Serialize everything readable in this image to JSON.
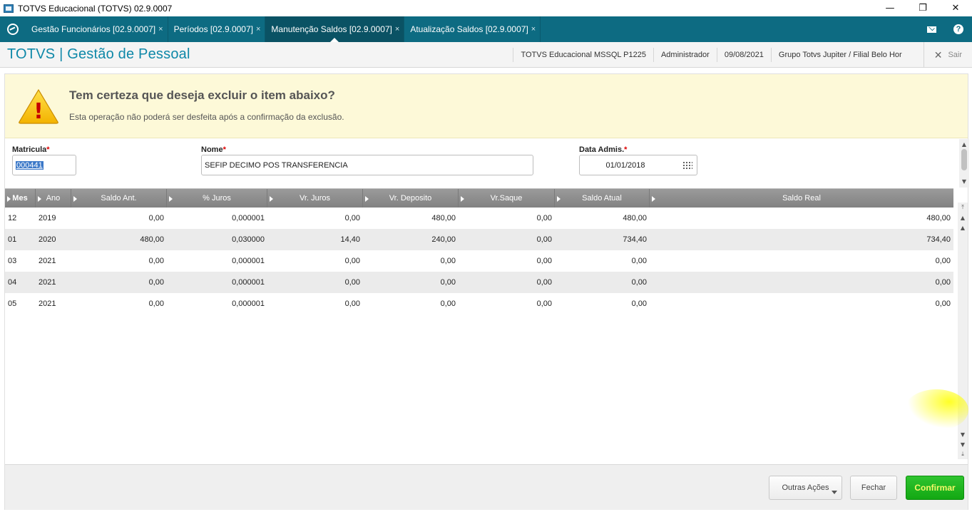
{
  "window": {
    "title": "TOTVS Educacional (TOTVS) 02.9.0007",
    "minimize_glyph": "—",
    "restore_glyph": "❐",
    "close_glyph": "✕"
  },
  "tabs": [
    {
      "label": "Gestão Funcionários [02.9.0007]",
      "active": false
    },
    {
      "label": "Períodos [02.9.0007]",
      "active": false
    },
    {
      "label": "Manutenção Saldos [02.9.0007]",
      "active": true
    },
    {
      "label": "Atualização Saldos [02.9.0007]",
      "active": false
    }
  ],
  "tab_close_glyph": "×",
  "header": {
    "brand": "TOTVS | Gestão de Pessoal",
    "server": "TOTVS Educacional MSSQL P1225",
    "user": "Administrador",
    "date": "09/08/2021",
    "company": "Grupo Totvs Jupiter / Filial Belo Hor",
    "logout_glyph": "✕",
    "logout_label": "Sair"
  },
  "icons": {
    "help_glyph": "?"
  },
  "warning": {
    "title": "Tem certeza que deseja excluir o item abaixo?",
    "subtitle": "Esta operação não poderá ser desfeita após a confirmação da exclusão.",
    "icon_glyph": "!"
  },
  "fields": {
    "matricula": {
      "label": "Matricula",
      "value": "000441"
    },
    "nome": {
      "label": "Nome",
      "value": "SEFIP DECIMO POS TRANSFERENCIA"
    },
    "data_admis": {
      "label": "Data Admis.",
      "value": "01/01/2018"
    },
    "required_mark": "*"
  },
  "grid": {
    "columns": [
      "Mes",
      "Ano",
      "Saldo Ant.",
      "% Juros",
      "Vr. Juros",
      "Vr. Deposito",
      "Vr.Saque",
      "Saldo Atual",
      "Saldo Real"
    ],
    "rows": [
      [
        "12",
        "2019",
        "0,00",
        "0,000001",
        "0,00",
        "480,00",
        "0,00",
        "480,00",
        "480,00"
      ],
      [
        "01",
        "2020",
        "480,00",
        "0,030000",
        "14,40",
        "240,00",
        "0,00",
        "734,40",
        "734,40"
      ],
      [
        "03",
        "2021",
        "0,00",
        "0,000001",
        "0,00",
        "0,00",
        "0,00",
        "0,00",
        "0,00"
      ],
      [
        "04",
        "2021",
        "0,00",
        "0,000001",
        "0,00",
        "0,00",
        "0,00",
        "0,00",
        "0,00"
      ],
      [
        "05",
        "2021",
        "0,00",
        "0,000001",
        "0,00",
        "0,00",
        "0,00",
        "0,00",
        "0,00"
      ]
    ]
  },
  "scroll_glyphs": {
    "up": "▲",
    "down": "▼",
    "top": "⤒",
    "bottom": "⤓"
  },
  "footer": {
    "outras_acoes": "Outras Ações",
    "fechar": "Fechar",
    "confirmar": "Confirmar"
  },
  "colors": {
    "tabbar": "#0d6b82",
    "brand": "#0e88a8",
    "warning_bg": "#fdf9d8",
    "confirm": "#13a813"
  }
}
